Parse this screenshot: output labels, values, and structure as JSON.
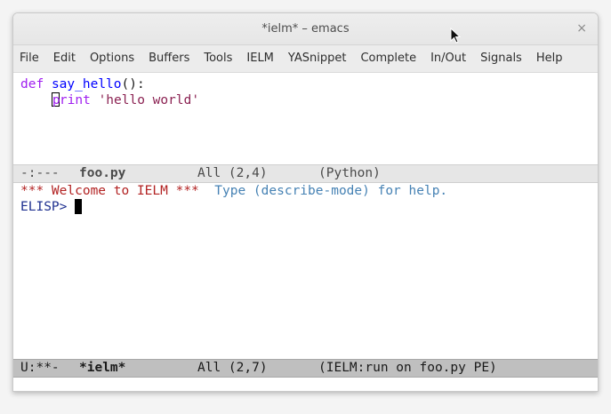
{
  "window": {
    "title": "*ielm* – emacs",
    "close_glyph": "×"
  },
  "menu": [
    "File",
    "Edit",
    "Options",
    "Buffers",
    "Tools",
    "IELM",
    "YASnippet",
    "Complete",
    "In/Out",
    "Signals",
    "Help"
  ],
  "editor": {
    "line1": {
      "kw": "def",
      "fn": "say_hello",
      "rest": "():"
    },
    "line2": {
      "indent": "    ",
      "cursor_char": "p",
      "kw_rest": "rint",
      "space": " ",
      "str": "'hello world'"
    }
  },
  "modeline_top": {
    "status": "-:---",
    "buffer": "foo.py",
    "position": "All (2,4)",
    "mode": "(Python)"
  },
  "ielm": {
    "welcome": "*** Welcome to IELM ***",
    "help": "Type (describe-mode) for help.",
    "prompt": "ELISP>"
  },
  "modeline_bottom": {
    "status": "U:**-",
    "buffer": "*ielm*",
    "position": "All (2,7)",
    "mode": "(IELM:run on foo.py PE)"
  },
  "colors": {
    "keyword": "#a020f0",
    "function": "#0000ff",
    "string": "#8b2252",
    "welcome": "#b22222",
    "help": "#4682b4",
    "prompt": "#1d2f8f"
  }
}
